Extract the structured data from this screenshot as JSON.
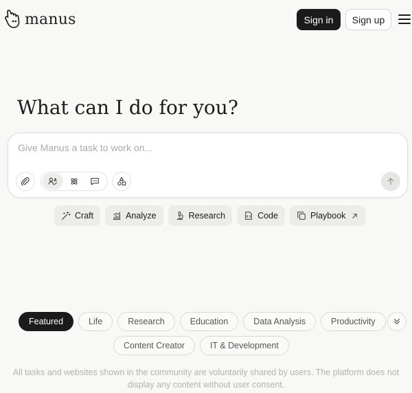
{
  "header": {
    "brand": "manus",
    "sign_in_label": "Sign in",
    "sign_up_label": "Sign up",
    "menu_icon": "hamburger-icon"
  },
  "hero": {
    "headline": "What can I do for you?"
  },
  "composer": {
    "placeholder": "Give Manus a task to work on...",
    "value": "",
    "icons": {
      "attach": "paperclip-icon",
      "modes": [
        "agent-mode-icon",
        "integration-icon",
        "chat-icon"
      ],
      "tools": "shapes-icon",
      "send": "arrow-up-icon"
    }
  },
  "quick_actions": [
    {
      "label": "Craft",
      "icon": "wand-icon"
    },
    {
      "label": "Analyze",
      "icon": "chart-icon"
    },
    {
      "label": "Research",
      "icon": "microscope-icon"
    },
    {
      "label": "Code",
      "icon": "code-file-icon"
    },
    {
      "label": "Playbook",
      "icon": "copy-icon"
    }
  ],
  "categories": {
    "row1": [
      "Featured",
      "Life",
      "Research",
      "Education",
      "Data Analysis",
      "Productivity"
    ],
    "row2": [
      "Content Creator",
      "IT & Development"
    ],
    "active": "Featured"
  },
  "footer": {
    "disclaimer": "All tasks and websites shown in the community are voluntarily shared by users. The platform does not display any content without user consent."
  },
  "colors": {
    "background": "#f8f8f7",
    "primary": "#1b1b1b",
    "chip_bg": "#ececea",
    "muted_text": "#b2b2b0"
  }
}
